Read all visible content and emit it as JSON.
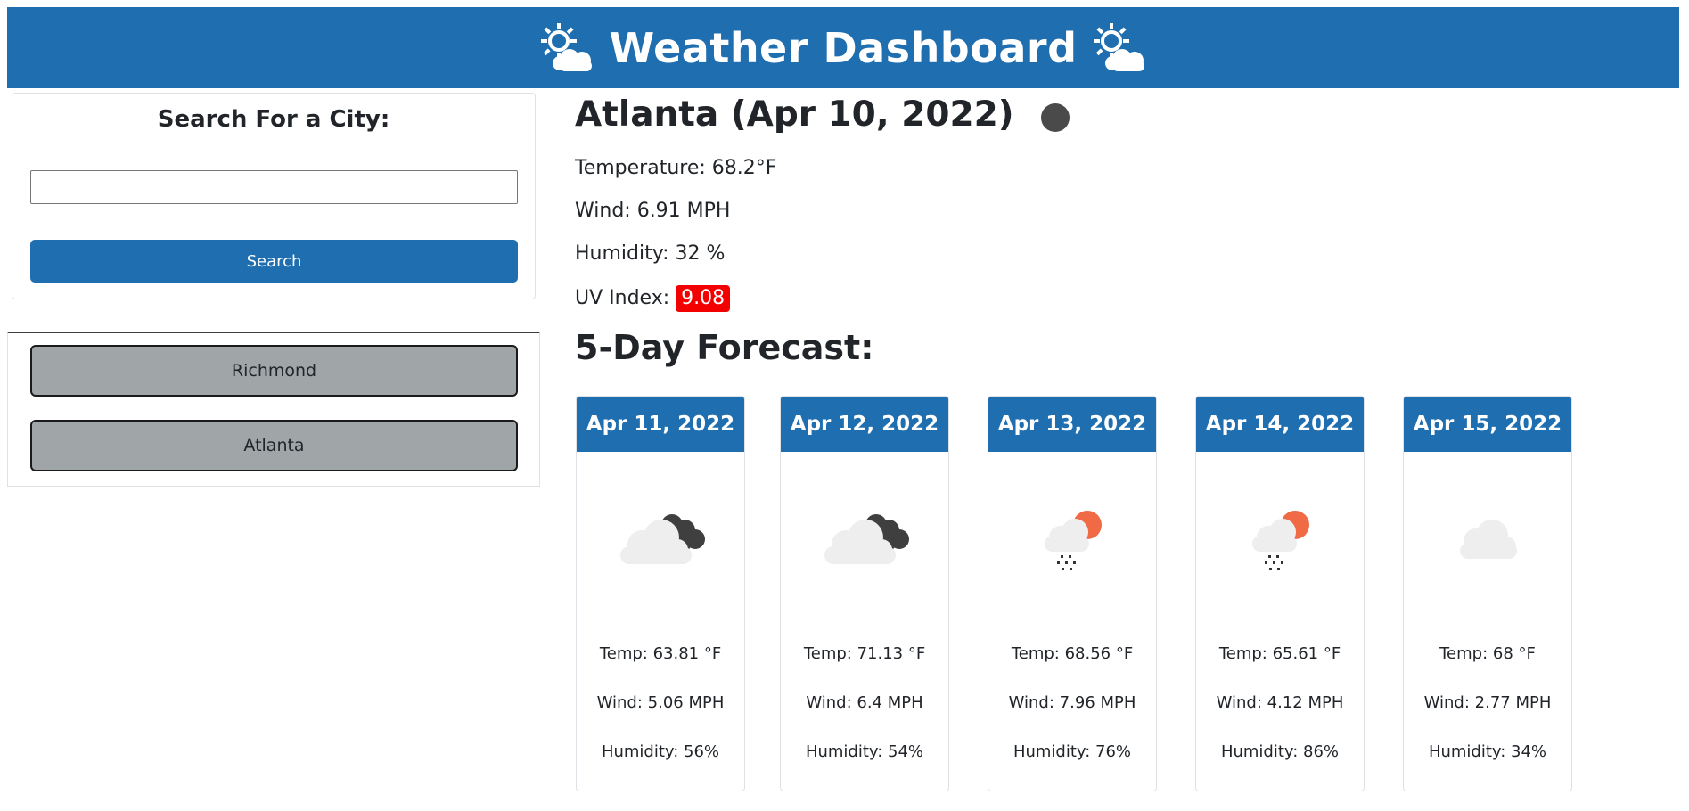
{
  "header": {
    "title": "Weather Dashboard",
    "icon_left": "sun-behind-cloud-icon",
    "icon_right": "sun-behind-cloud-icon",
    "background": "#1f6eb0"
  },
  "search": {
    "heading": "Search For a City:",
    "input_value": "",
    "placeholder": "",
    "button_label": "Search"
  },
  "history": {
    "cities": [
      "Richmond",
      "Atlanta"
    ]
  },
  "current": {
    "city_date": "Atlanta (Apr 10, 2022)",
    "condition_icon": "weather-condition-dot-icon",
    "temperature": "Temperature: 68.2°F",
    "wind": "Wind: 6.91 MPH",
    "humidity": "Humidity: 32 %",
    "uv_label": "UV Index:",
    "uv_value": "9.08",
    "uv_color": "#f30000"
  },
  "forecast": {
    "title": "5-Day Forecast:",
    "days": [
      {
        "date": "Apr 11, 2022",
        "icon": "cloudy-night-icon",
        "temp": "Temp: 63.81 °F",
        "wind": "Wind: 5.06 MPH",
        "humidity": "Humidity: 56%"
      },
      {
        "date": "Apr 12, 2022",
        "icon": "cloudy-night-icon",
        "temp": "Temp: 71.13 °F",
        "wind": "Wind: 6.4 MPH",
        "humidity": "Humidity: 54%"
      },
      {
        "date": "Apr 13, 2022",
        "icon": "rain-sun-icon",
        "temp": "Temp: 68.56 °F",
        "wind": "Wind: 7.96 MPH",
        "humidity": "Humidity: 76%"
      },
      {
        "date": "Apr 14, 2022",
        "icon": "rain-sun-icon",
        "temp": "Temp: 65.61 °F",
        "wind": "Wind: 4.12 MPH",
        "humidity": "Humidity: 86%"
      },
      {
        "date": "Apr 15, 2022",
        "icon": "cloud-icon",
        "temp": "Temp: 68 °F",
        "wind": "Wind: 2.77 MPH",
        "humidity": "Humidity: 34%"
      }
    ]
  }
}
